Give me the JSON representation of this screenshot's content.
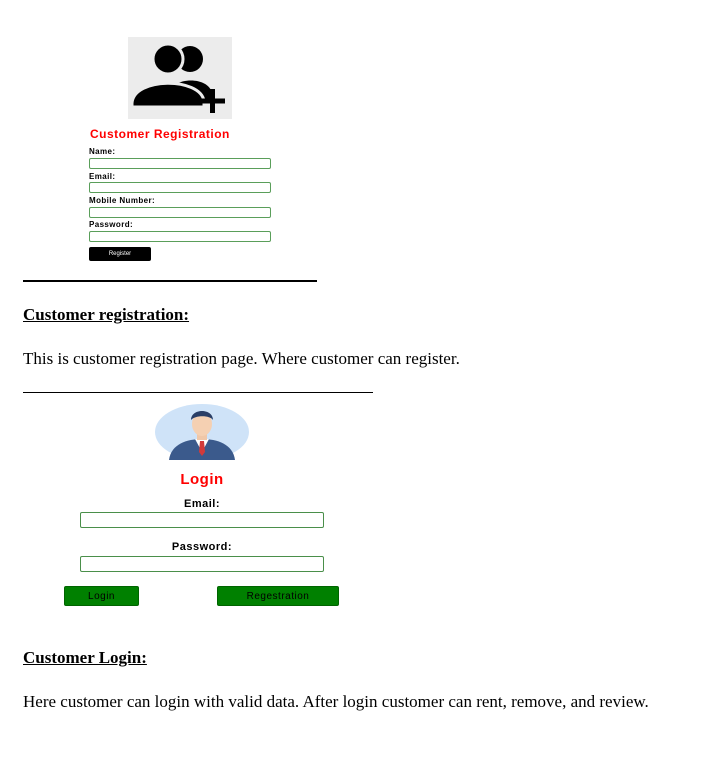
{
  "registration_figure": {
    "icon": "add-user-icon",
    "title": "Customer Registration",
    "fields": [
      {
        "label": "Name:"
      },
      {
        "label": "Email:"
      },
      {
        "label": "Mobile Number:"
      },
      {
        "label": "Password:"
      }
    ],
    "button_label": "Register",
    "title_color": "#ff0000"
  },
  "section1": {
    "heading": "Customer registration:",
    "text": "This is customer registration page. Where customer can register."
  },
  "login_figure": {
    "icon": "user-avatar-icon",
    "title": "Login",
    "email_label": "Email:",
    "password_label": "Password:",
    "login_button": "Login",
    "registration_button": "Regestration",
    "button_color": "#008000"
  },
  "section2": {
    "heading": "Customer Login:",
    "text": "Here customer can login with valid data. After login customer can rent, remove, and review."
  }
}
